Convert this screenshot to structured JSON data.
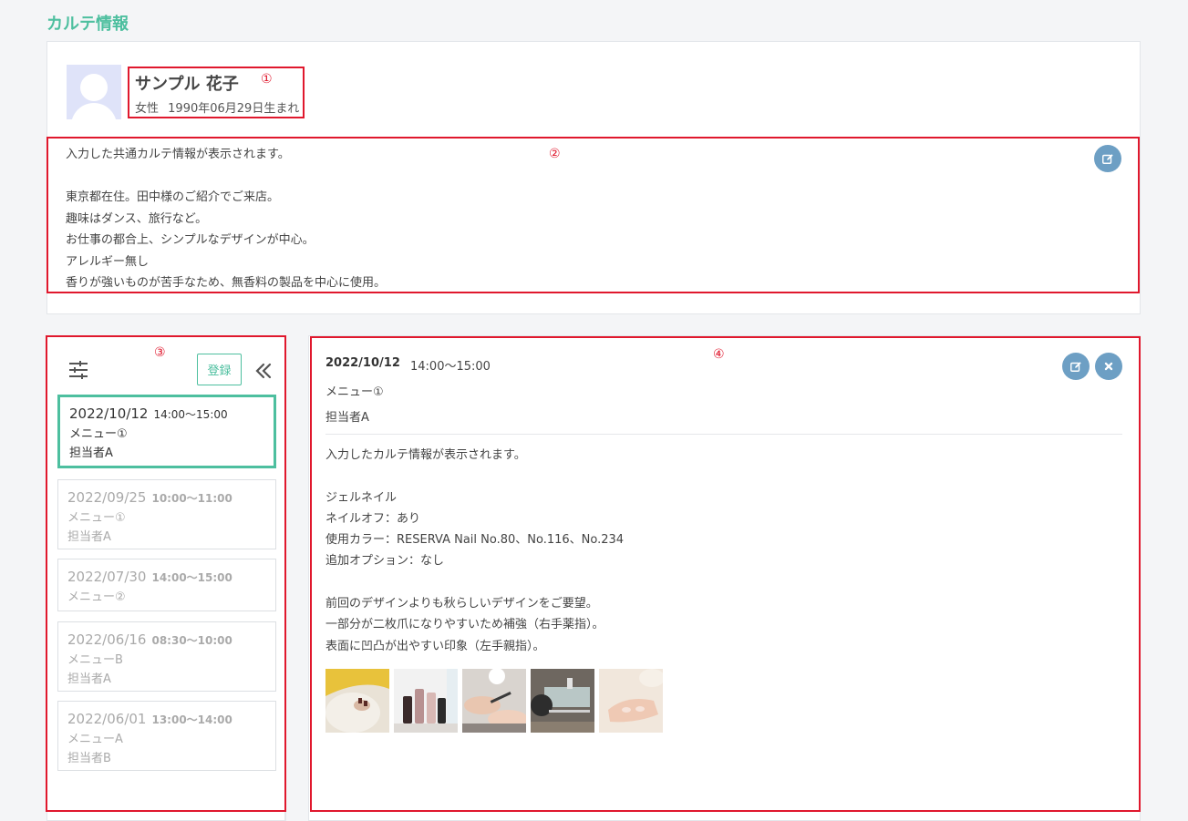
{
  "page": {
    "title": "カルテ情報"
  },
  "customer": {
    "name": "サンプル 花子",
    "gender": "女性",
    "birth": "1990年06月29日生まれ",
    "notes": [
      "入力した共通カルテ情報が表示されます。",
      "",
      "東京都在住。田中様のご紹介でご来店。",
      "趣味はダンス、旅行など。",
      "お仕事の都合上、シンプルなデザインが中心。",
      "アレルギー無し",
      "香りが強いものが苦手なため、無香料の製品を中心に使用。"
    ]
  },
  "annotations": [
    "①",
    "②",
    "③",
    "④"
  ],
  "history": {
    "register_label": "登録",
    "items": [
      {
        "date": "2022/10/12",
        "time": "14:00～15:00",
        "menu": "メニュー①",
        "staff": "担当者A",
        "active": true
      },
      {
        "date": "2022/09/25",
        "time": "10:00～11:00",
        "menu": "メニュー①",
        "staff": "担当者A",
        "active": false
      },
      {
        "date": "2022/07/30",
        "time": "14:00～15:00",
        "menu": "メニュー②",
        "staff": "",
        "active": false
      },
      {
        "date": "2022/06/16",
        "time": "08:30～10:00",
        "menu": "メニューB",
        "staff": "担当者A",
        "active": false
      },
      {
        "date": "2022/06/01",
        "time": "13:00～14:00",
        "menu": "メニューA",
        "staff": "担当者B",
        "active": false
      }
    ]
  },
  "detail": {
    "date": "2022/10/12",
    "time": "14:00～15:00",
    "menu": "メニュー①",
    "staff": "担当者A",
    "notes": [
      "入力したカルテ情報が表示されます。",
      "",
      "ジェルネイル",
      "ネイルオフ：あり",
      "使用カラー：RESERVA Nail No.80、No.116、No.234",
      "追加オプション：なし",
      "",
      "前回のデザインよりも秋らしいデザインをご要望。",
      "一部分が二枚爪になりやすいため補強（右手薬指）。",
      "表面に凹凸が出やすい印象（左手親指）。"
    ],
    "photos": [
      "nail-photo-1",
      "nail-photo-2",
      "nail-photo-3",
      "nail-photo-4",
      "nail-photo-5"
    ]
  },
  "colors": {
    "accent": "#4dbf9f",
    "annotation": "#e0182d",
    "icon_button": "#6d9fc4"
  }
}
